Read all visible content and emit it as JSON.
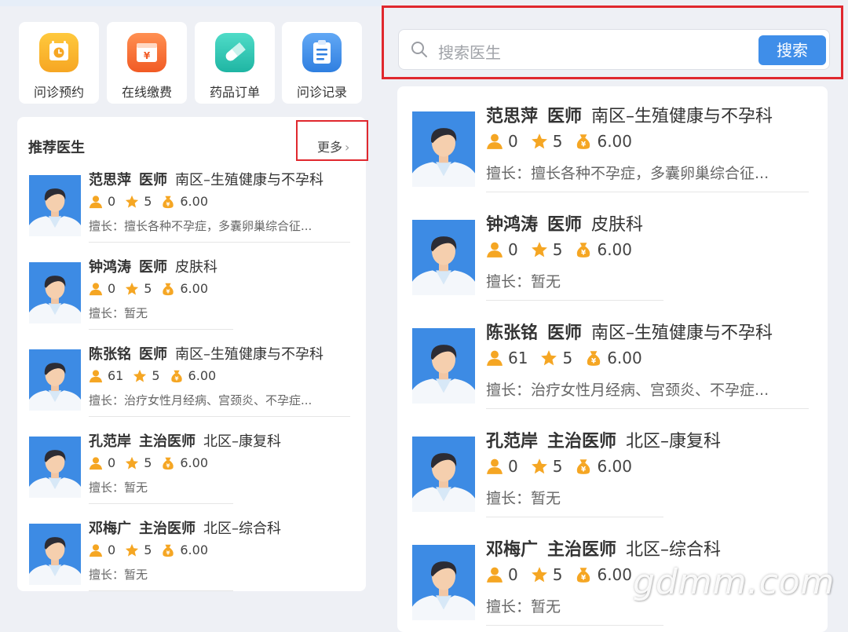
{
  "quick_actions": [
    {
      "label": "问诊预约",
      "icon": "clock-icon",
      "color": "#f6a623"
    },
    {
      "label": "在线缴费",
      "icon": "payment-icon",
      "color": "#f36b2c"
    },
    {
      "label": "药品订单",
      "icon": "pill-icon",
      "color": "#2ec4b2"
    },
    {
      "label": "问诊记录",
      "icon": "clipboard-icon",
      "color": "#3d8be4"
    }
  ],
  "recommend": {
    "title": "推荐医生",
    "more_label": "更多",
    "more_arrow": "›"
  },
  "search": {
    "placeholder": "搜索医生",
    "button_label": "搜索"
  },
  "doctors": [
    {
      "name": "范思萍",
      "title": "医师",
      "dept": "南区–生殖健康与不孕科",
      "consults": "0",
      "rating": "5",
      "price": "6.00",
      "skill": "擅长：擅长各种不孕症，多囊卵巢综合征..."
    },
    {
      "name": "钟鸿涛",
      "title": "医师",
      "dept": "皮肤科",
      "consults": "0",
      "rating": "5",
      "price": "6.00",
      "skill": "擅长：暂无"
    },
    {
      "name": "陈张铭",
      "title": "医师",
      "dept": "南区–生殖健康与不孕科",
      "consults": "61",
      "rating": "5",
      "price": "6.00",
      "skill": "擅长：治疗女性月经病、宫颈炎、不孕症..."
    },
    {
      "name": "孔范岸",
      "title": "主治医师",
      "dept": "北区–康复科",
      "consults": "0",
      "rating": "5",
      "price": "6.00",
      "skill": "擅长：暂无"
    },
    {
      "name": "邓梅广",
      "title": "主治医师",
      "dept": "北区–综合科",
      "consults": "0",
      "rating": "5",
      "price": "6.00",
      "skill": "擅长：暂无"
    }
  ],
  "watermark": "gdmm.com",
  "colors": {
    "highlight_border": "#e0282e",
    "search_button": "#3f8ee9",
    "avatar_bg": "#3d8be4",
    "icon_gold": "#f5a623"
  }
}
